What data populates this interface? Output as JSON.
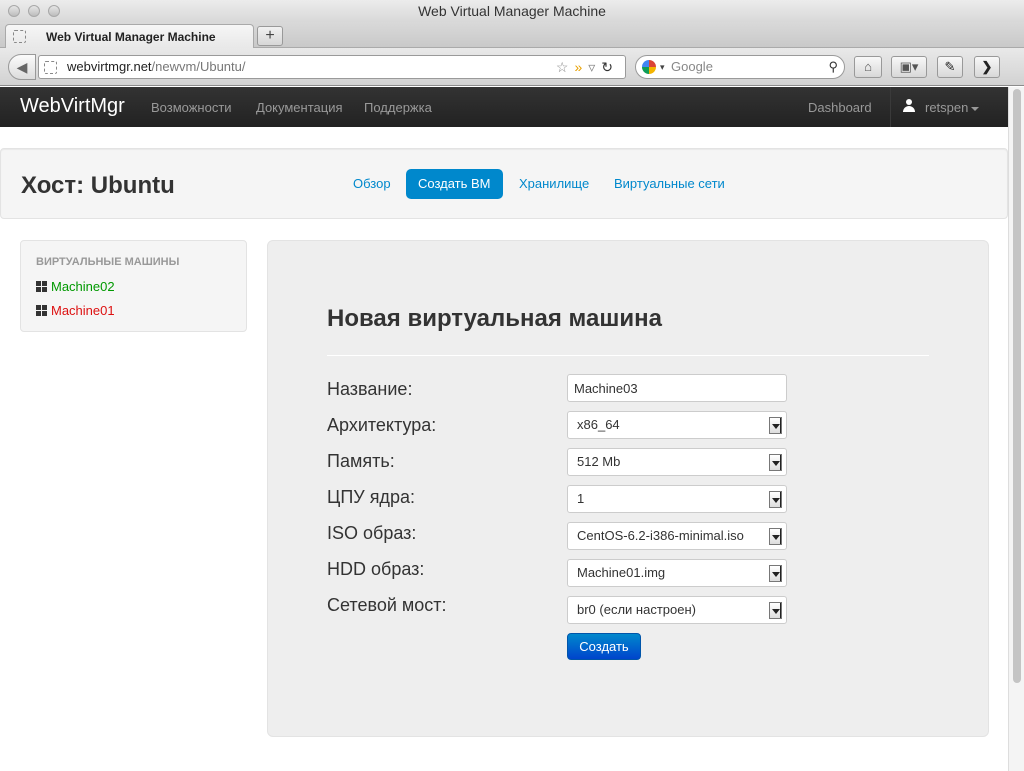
{
  "window": {
    "title": "Web Virtual Manager Machine"
  },
  "tab": {
    "title": "Web Virtual Manager Machine",
    "new_tab": "+"
  },
  "address": {
    "host": "webvirtmgr.net",
    "path": "/newvm/Ubuntu/"
  },
  "search": {
    "placeholder": "Google"
  },
  "site_nav": {
    "brand": "WebVirtMgr",
    "links": [
      "Возможности",
      "Документация",
      "Поддержка"
    ],
    "dashboard": "Dashboard",
    "user": "retspen"
  },
  "host": {
    "title": "Хост: Ubuntu",
    "tabs": [
      {
        "label": "Обзор",
        "active": false
      },
      {
        "label": "Создать ВМ",
        "active": true
      },
      {
        "label": "Хранилище",
        "active": false
      },
      {
        "label": "Виртуальные сети",
        "active": false
      }
    ]
  },
  "sidebar": {
    "header": "Виртуальные машины",
    "machines": [
      {
        "name": "Machine02",
        "color": "#009900"
      },
      {
        "name": "Machine01",
        "color": "#dd1111"
      }
    ]
  },
  "form": {
    "title": "Новая виртуальная машина",
    "name_label": "Название:",
    "name_value": "Machine03",
    "arch_label": "Архитектура:",
    "arch_value": "x86_64",
    "mem_label": "Память:",
    "mem_value": "512 Mb",
    "cpu_label": "ЦПУ ядра:",
    "cpu_value": "1",
    "iso_label": "ISO образ:",
    "iso_value": "CentOS-6.2-i386-minimal.iso",
    "hdd_label": "HDD образ:",
    "hdd_value": "Machine01.img",
    "bridge_label": "Сетевой мост:",
    "bridge_value": "br0 (если настроен)",
    "submit": "Создать"
  },
  "colors": {
    "accent": "#0088cc",
    "navbar": "#222222"
  }
}
